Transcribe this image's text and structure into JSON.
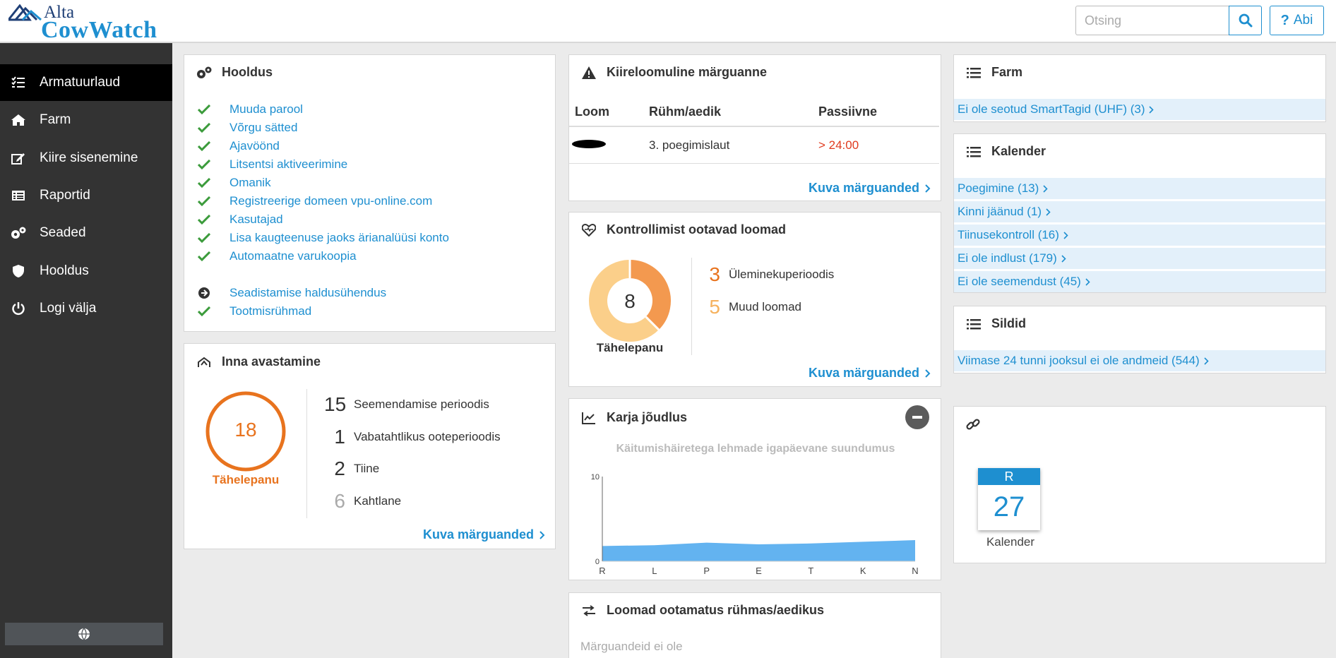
{
  "header": {
    "logo_top": "Alta",
    "logo_bottom": "CowWatch",
    "search_placeholder": "Otsing",
    "help_label": "Abi",
    "help_glyph": "?"
  },
  "sidebar": {
    "items": [
      {
        "label": "Armatuurlaud",
        "icon": "dashboard-list-icon",
        "active": true
      },
      {
        "label": "Farm",
        "icon": "home-icon"
      },
      {
        "label": "Kiire sisenemine",
        "icon": "edit-icon"
      },
      {
        "label": "Raportid",
        "icon": "report-icon"
      },
      {
        "label": "Seaded",
        "icon": "gears-icon"
      },
      {
        "label": "Hooldus",
        "icon": "shield-icon"
      },
      {
        "label": "Logi välja",
        "icon": "power-icon"
      }
    ],
    "language_icon": "globe-icon"
  },
  "maintenance": {
    "title": "Hooldus",
    "items": [
      "Muuda parool",
      "Võrgu sätted",
      "Ajavöönd",
      "Litsentsi aktiveerimine",
      "Omanik",
      "Registreerige domeen vpu-online.com",
      "Kasutajad",
      "Lisa kaugteenuse jaoks ärianalüüsi konto",
      "Automaatne varukoopia"
    ],
    "extra_items": [
      {
        "label": "Seadistamise haldusühendus",
        "icon": "arrow-circle-icon"
      },
      {
        "label": "Tootmisrühmad",
        "icon": "check-icon"
      }
    ]
  },
  "heat": {
    "title": "Inna avastamine",
    "total": "18",
    "total_label": "Tähelepanu",
    "stats": [
      {
        "count": "15",
        "label": "Seemendamise perioodis"
      },
      {
        "count": "1",
        "label": "Vabatahtlikus ooteperioodis"
      },
      {
        "count": "2",
        "label": "Tiine"
      },
      {
        "count": "6",
        "label": "Kahtlane"
      }
    ],
    "more_label": "Kuva märguanded"
  },
  "urgent": {
    "title": "Kiireloomuline märguanne",
    "columns": [
      "Loom",
      "Rühm/aedik",
      "Passiivne"
    ],
    "rows": [
      {
        "animal": "",
        "group": "3. poegimislaut",
        "passive": "> 24:00"
      }
    ],
    "more_label": "Kuva märguanded"
  },
  "checkup": {
    "title": "Kontrollimist ootavad loomad",
    "total": "8",
    "total_label": "Tähelepanu",
    "stats": [
      {
        "count": "3",
        "label": "Üleminekuperioodis",
        "value": 3,
        "color": "#f3994f"
      },
      {
        "count": "5",
        "label": "Muud loomad",
        "value": 5,
        "color": "#fbcf8a"
      }
    ],
    "more_label": "Kuva märguanded"
  },
  "herd": {
    "title": "Karja jõudlus",
    "chart_data": {
      "type": "area",
      "title": "Käitumishäiretega lehmade igapäevane suundumus",
      "categories": [
        "R",
        "L",
        "P",
        "E",
        "T",
        "K",
        "N"
      ],
      "values": [
        1.8,
        1.9,
        2.2,
        2.0,
        2.1,
        2.3,
        2.5
      ],
      "ylim": [
        0,
        10
      ],
      "yticks": [
        "0",
        "10"
      ],
      "color": "#63b3f0"
    }
  },
  "waiting": {
    "title": "Loomad ootamatus rühmas/aedikus",
    "empty_label": "Märguandeid ei ole"
  },
  "farm": {
    "title": "Farm",
    "links": [
      "Ei ole seotud SmartTagid (UHF) (3)"
    ]
  },
  "calendar": {
    "title": "Kalender",
    "links": [
      "Poegimine (13)",
      "Kinni jäänud (1)",
      "Tiinusekontroll (16)",
      "Ei ole indlust (179)",
      "Ei ole seemendust (45)"
    ]
  },
  "tags": {
    "title": "Sildid",
    "links": [
      "Viimase 24 tunni jooksul ei ole andmeid (544)"
    ]
  },
  "links_card": {
    "icon": "link-icon",
    "calendar_weekday": "R",
    "calendar_day": "27",
    "calendar_label": "Kalender"
  },
  "colors": {
    "accent": "#1e8fd0",
    "orange": "#e8731e",
    "check_green": "#3b9b3b",
    "alert_red": "#e03a1e"
  }
}
